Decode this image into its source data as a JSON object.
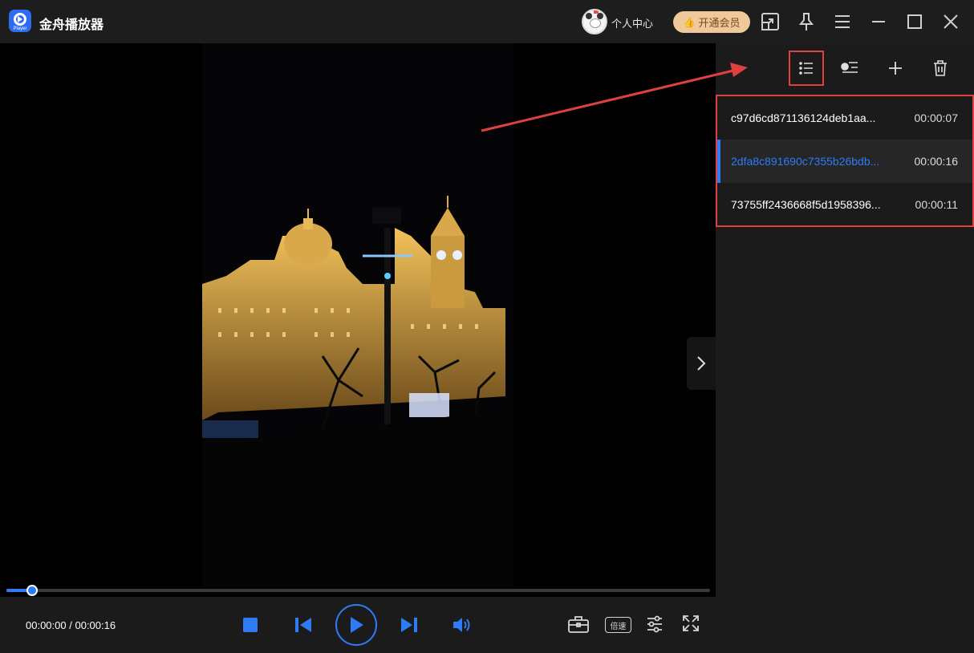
{
  "app": {
    "title": "金舟播放器",
    "logo_tag": "Player"
  },
  "header": {
    "user_center": "个人中心",
    "vip_button": "开通会员",
    "icons": [
      "screencast-icon",
      "pin-icon",
      "menu-icon",
      "minimize-icon",
      "maximize-icon",
      "close-icon"
    ]
  },
  "player": {
    "time_current": "00:00:00",
    "time_separator": "/",
    "time_total": "00:00:16",
    "progress_fraction": 0.037,
    "speed_label": "倍速"
  },
  "playlist": {
    "items": [
      {
        "name": "c97d6cd871136124deb1aa...",
        "duration": "00:00:07",
        "selected": false
      },
      {
        "name": "2dfa8c891690c7355b26bdb...",
        "duration": "00:00:16",
        "selected": true
      },
      {
        "name": "73755ff2436668f5d1958396...",
        "duration": "00:00:11",
        "selected": false
      }
    ]
  },
  "colors": {
    "accent": "#2d7cf6",
    "highlight_red": "#e04040",
    "vip_gold": "#f0c99a",
    "background": "#1b1b1b"
  }
}
